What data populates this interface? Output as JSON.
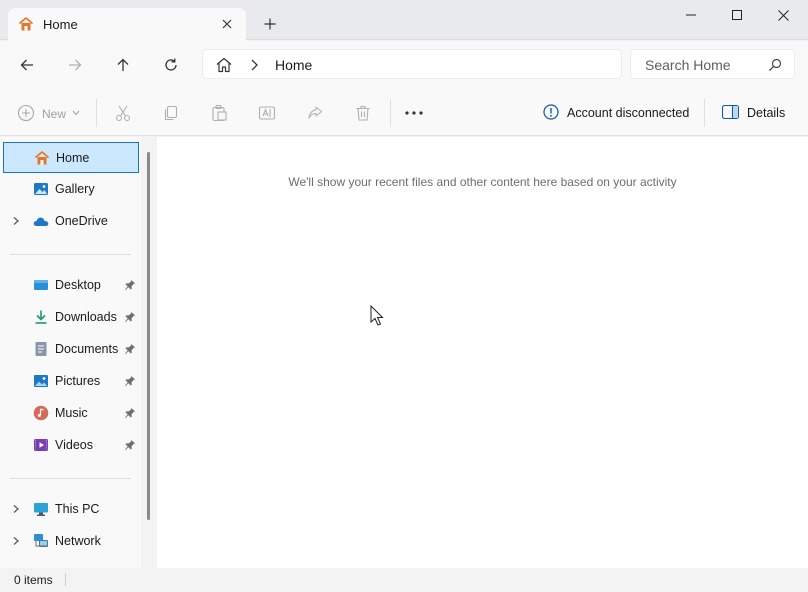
{
  "tab": {
    "title": "Home",
    "icon": "home-icon"
  },
  "window_controls": [
    "minimize-icon",
    "maximize-icon",
    "close-icon"
  ],
  "address": {
    "path": "Home"
  },
  "search": {
    "placeholder": "Search Home"
  },
  "command_bar": {
    "new_label": "New",
    "account_status": "Account disconnected",
    "details_label": "Details"
  },
  "sidebar": {
    "items": [
      {
        "label": "Home",
        "icon": "home-icon",
        "selected": true
      },
      {
        "label": "Gallery",
        "icon": "gallery-icon"
      },
      {
        "label": "OneDrive",
        "icon": "cloud-icon",
        "expandable": true
      },
      {
        "label": "Desktop",
        "icon": "desktop-icon",
        "pinned": true
      },
      {
        "label": "Downloads",
        "icon": "download-icon",
        "pinned": true
      },
      {
        "label": "Documents",
        "icon": "document-icon",
        "pinned": true
      },
      {
        "label": "Pictures",
        "icon": "pictures-icon",
        "pinned": true
      },
      {
        "label": "Music",
        "icon": "music-icon",
        "pinned": true
      },
      {
        "label": "Videos",
        "icon": "videos-icon",
        "pinned": true
      },
      {
        "label": "This PC",
        "icon": "computer-icon",
        "expandable": true
      },
      {
        "label": "Network",
        "icon": "network-icon",
        "expandable": true
      }
    ]
  },
  "content": {
    "empty_message": "We'll show your recent files and other content here based on your activity"
  },
  "status": {
    "item_count": "0 items"
  },
  "colors": {
    "accent": "#1a73c9",
    "selected_bg": "#cce8ff",
    "home_orange": "#e8742a"
  }
}
